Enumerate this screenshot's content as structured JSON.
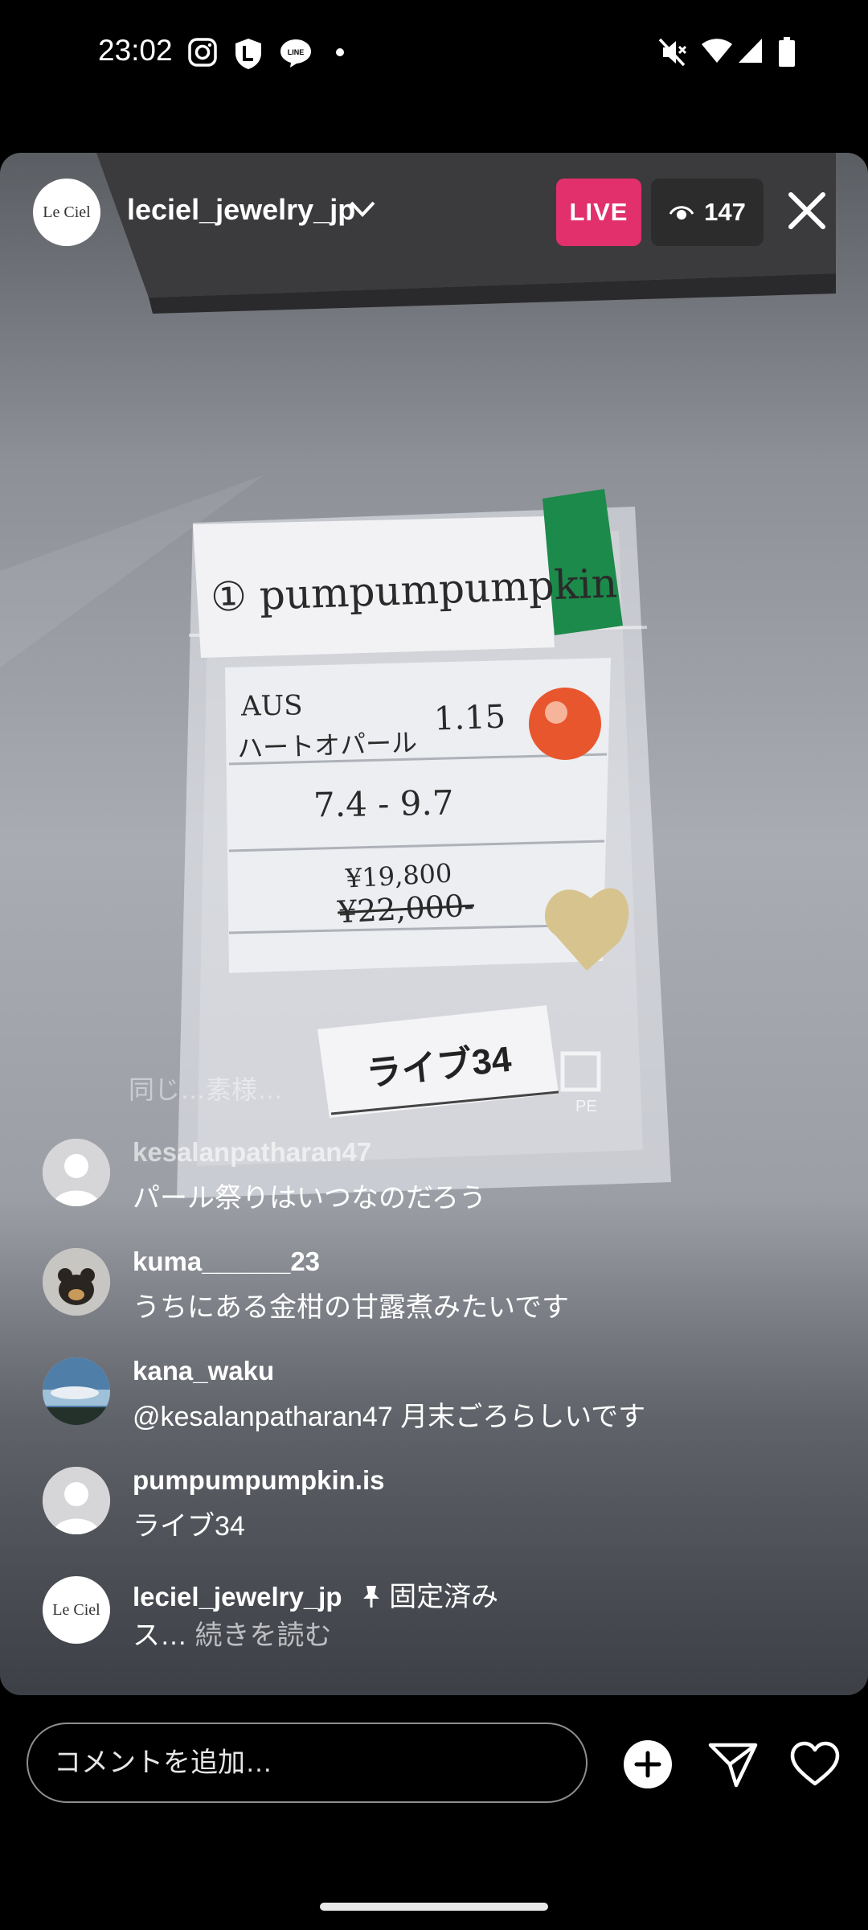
{
  "status_bar": {
    "time": "23:02",
    "left_icons": [
      "instagram-icon",
      "l-shield-icon",
      "line-app-icon",
      "dot-icon"
    ],
    "right_icons": [
      "mute-icon",
      "wifi-icon",
      "signal-icon",
      "battery-icon"
    ]
  },
  "live": {
    "host": {
      "username": "leciel_jewelry_jp",
      "avatar_text": "Le Ciel"
    },
    "live_label": "LIVE",
    "viewer_count": "147"
  },
  "video": {
    "label_name": "① pumpumpumpkin",
    "line_origin": "AUS",
    "line_stone": "ハートオパール",
    "line_carat": "1.15",
    "line_size": "7.4 - 9.7",
    "price_new": "¥19,800",
    "price_old": "¥22,000-",
    "tag": "ライブ34",
    "pe_mark": "PE"
  },
  "comments": {
    "faded_text": "同じ…素様…",
    "items": [
      {
        "username": "kesalanpatharan47",
        "text": "パール祭りはいつなのだろう"
      },
      {
        "username": "kuma______23",
        "text": "うちにある金柑の甘露煮みたいです"
      },
      {
        "username": "kana_waku",
        "text": "@kesalanpatharan47 月末ごろらしいです"
      },
      {
        "username": "pumpumpumpkin.is",
        "text": "ライブ34"
      },
      {
        "username": "leciel_jewelry_jp",
        "pin_label": "固定済み",
        "text": "ス…",
        "more": "続きを読む",
        "avatar_text": "Le Ciel"
      }
    ]
  },
  "bottom_bar": {
    "comment_placeholder": "コメントを追加…",
    "icons": [
      "add-circle-icon",
      "send-icon",
      "heart-icon"
    ]
  },
  "colors": {
    "live_badge": "#e1306c",
    "background": "#000000"
  }
}
